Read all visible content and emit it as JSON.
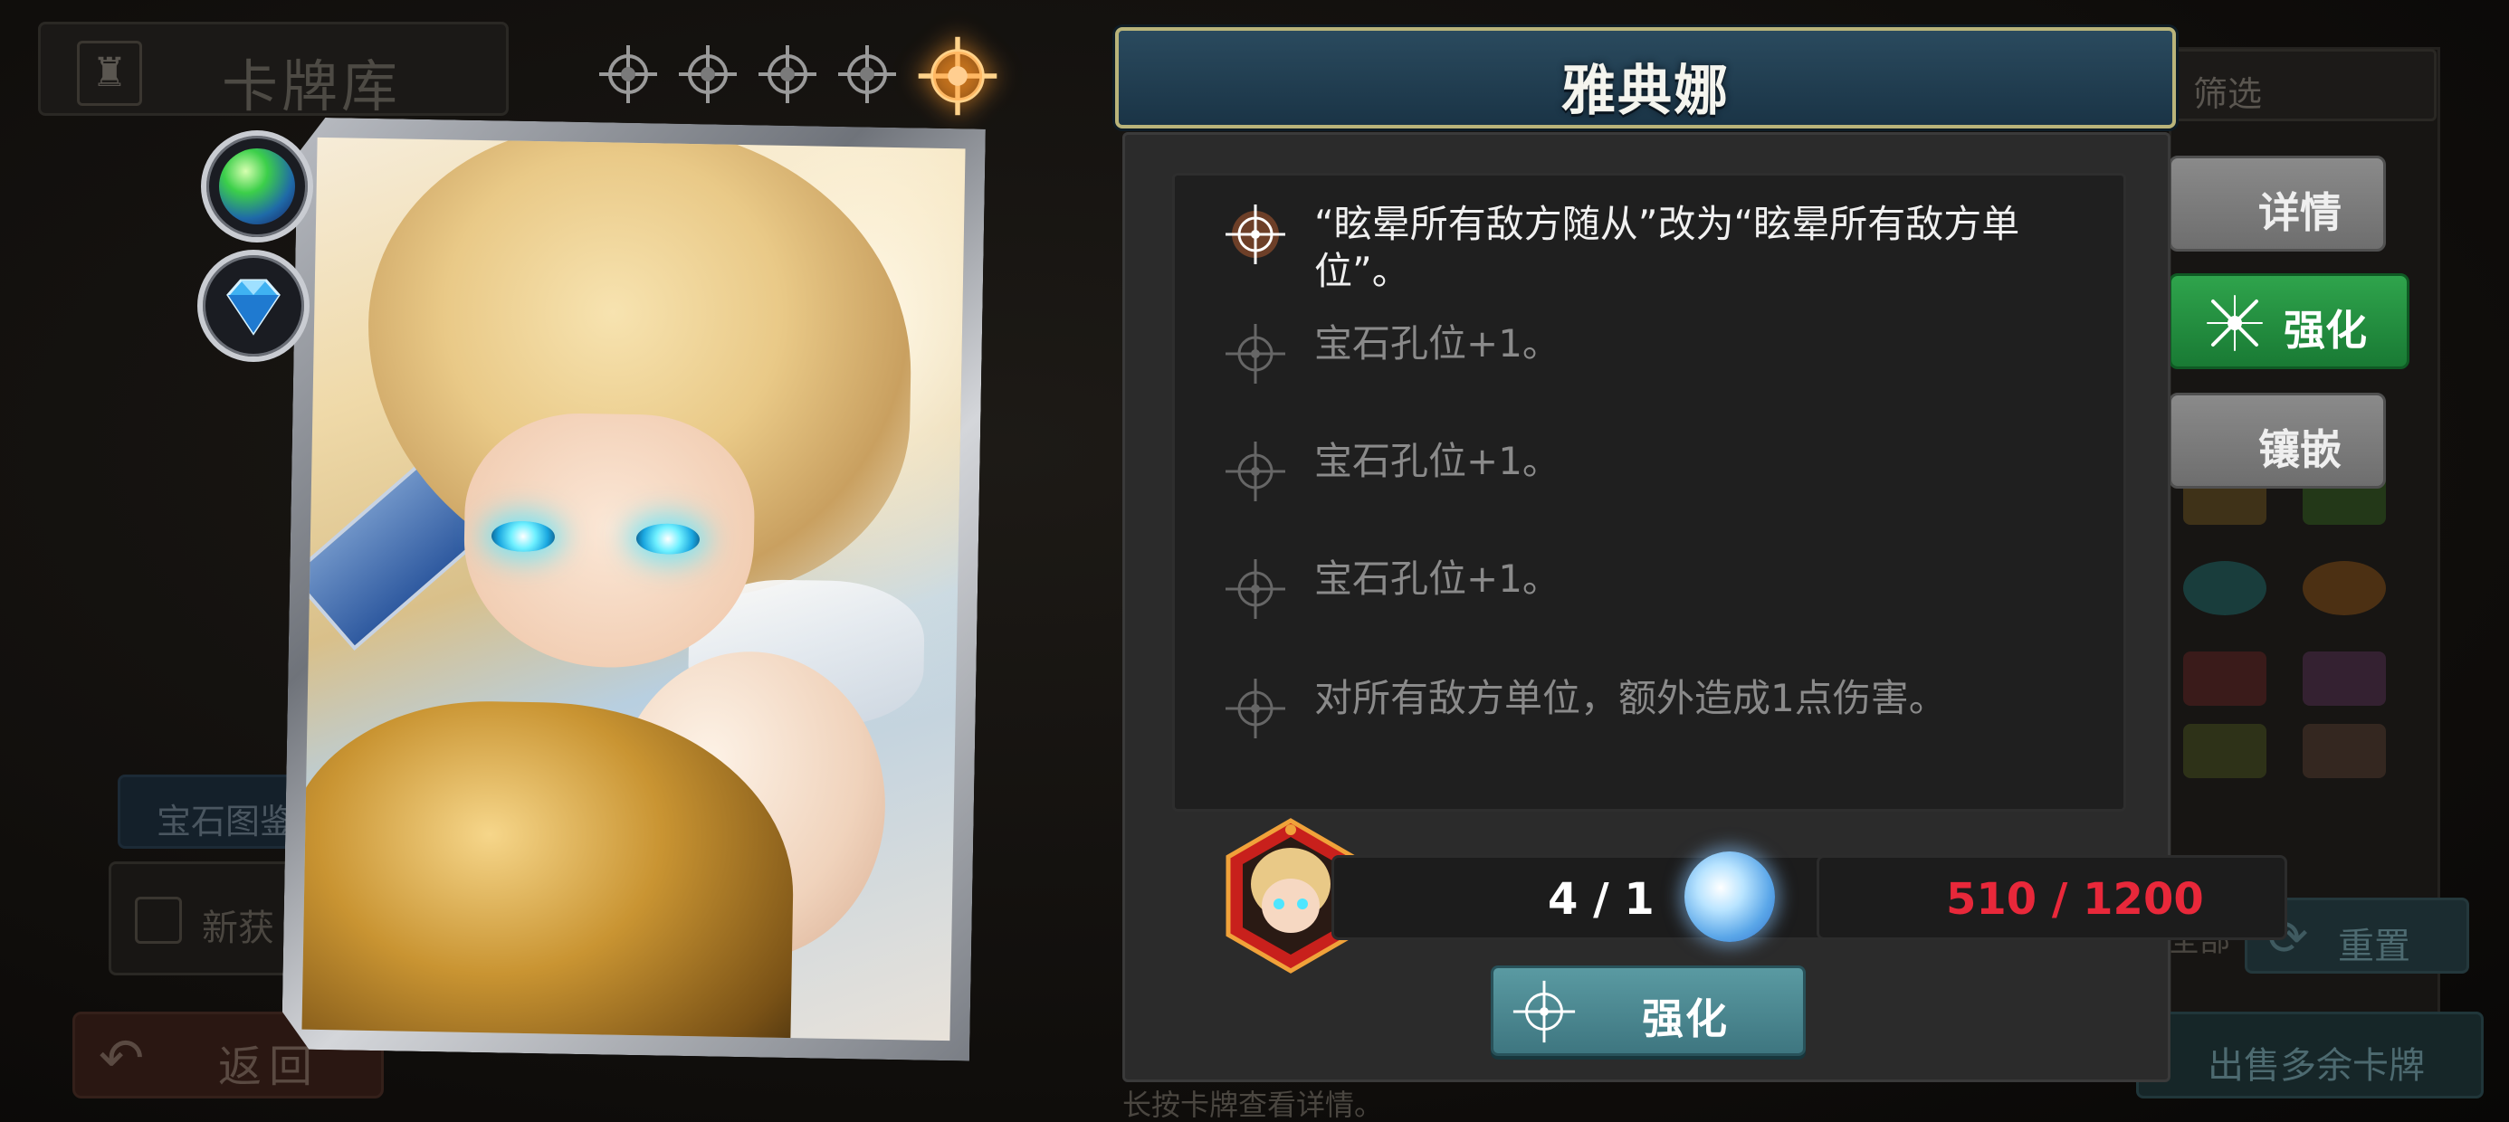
{
  "background_panel": {
    "title": "卡牌库",
    "gem_dex_button": "宝石图鉴",
    "new_get_label": "新获",
    "back_button": "返回",
    "hint": "长按卡牌查看详情。"
  },
  "card": {
    "stars_total": 5,
    "stars_active": 1,
    "gems": [
      "green-orb-gem",
      "blue-diamond-gem"
    ]
  },
  "dialog": {
    "title": "雅典娜",
    "upgrades": [
      {
        "text": "“眩晕所有敌方随从”改为“眩晕所有敌方单位”。",
        "active": true
      },
      {
        "text": "宝石孔位+1。",
        "active": false
      },
      {
        "text": "宝石孔位+1。",
        "active": false
      },
      {
        "text": "宝石孔位+1。",
        "active": false
      },
      {
        "text": "对所有敌方单位，额外造成1点伤害。",
        "active": false
      }
    ],
    "card_count": "4 / 1",
    "dust_count": "510 / 1200",
    "enhance_button": "强化"
  },
  "right_panel": {
    "filter_label": "筛选",
    "detail_button": "详情",
    "enhance_button": "强化",
    "inlay_button": "镶嵌",
    "all_label": "全部",
    "reset_button": "重置",
    "sell_button": "出售多余卡牌"
  },
  "colors": {
    "enhance_green": "#197a34",
    "dust_red": "#e8283a",
    "title_blue": "#2a4a5e",
    "star_orange": "#ff9a2a"
  }
}
